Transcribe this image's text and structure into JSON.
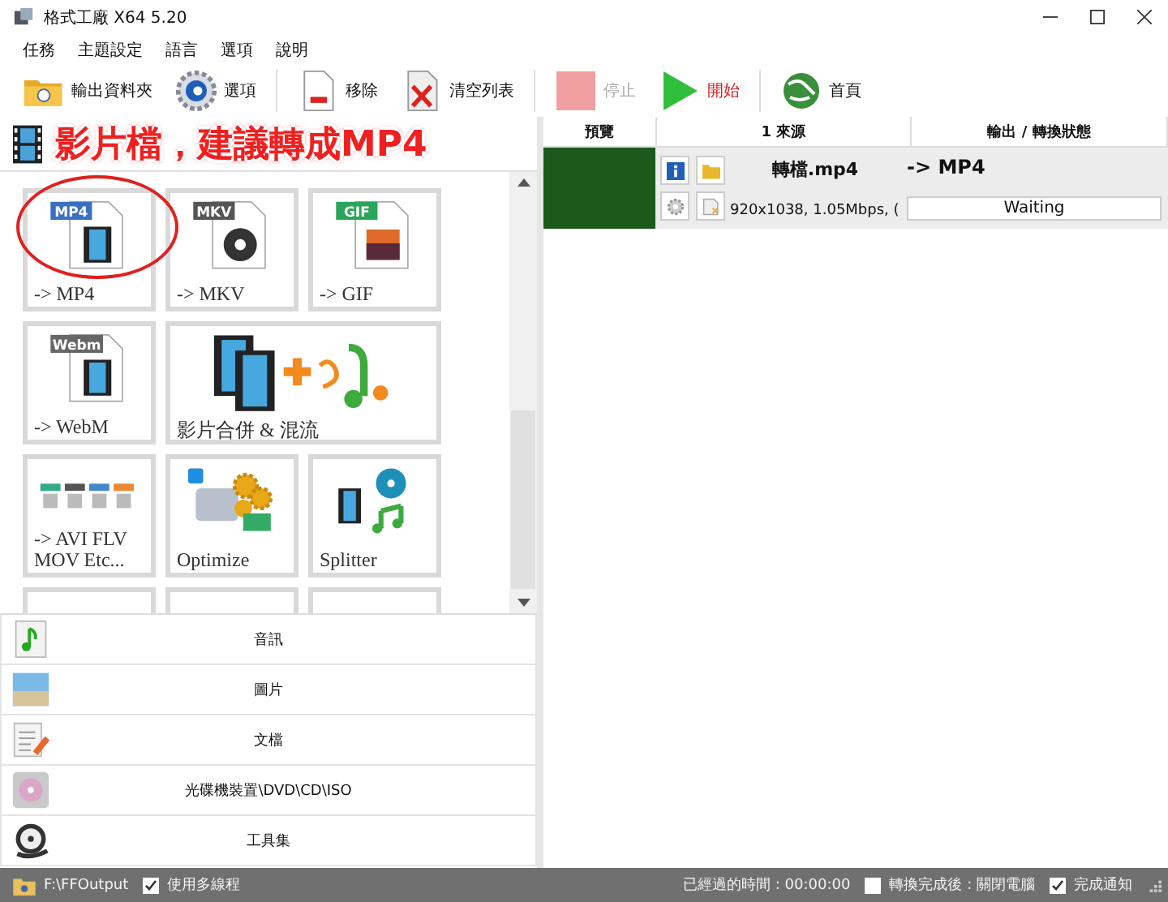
{
  "window": {
    "title": "格式工廠 X64 5.20"
  },
  "menu": [
    "任務",
    "主題設定",
    "語言",
    "選項",
    "說明"
  ],
  "toolbar": [
    {
      "label": "輸出資料夾",
      "kind": "folder",
      "disabled": false
    },
    {
      "label": "選項",
      "kind": "gear",
      "disabled": false
    },
    {
      "label": "移除",
      "kind": "remove",
      "disabled": false
    },
    {
      "label": "清空列表",
      "kind": "clear",
      "disabled": false
    },
    {
      "label": "停止",
      "kind": "stop",
      "disabled": true
    },
    {
      "label": "開始",
      "kind": "start",
      "disabled": false
    },
    {
      "label": "首頁",
      "kind": "home",
      "disabled": false
    }
  ],
  "category_header": {
    "title": "影片檔，建議轉成MP4"
  },
  "tiles": [
    {
      "label": "-> MP4",
      "kind": "file",
      "badge": "MP4",
      "color": "#3b6fc4",
      "circled": true
    },
    {
      "label": "-> MKV",
      "kind": "disc",
      "badge": "MKV",
      "color": "#555555",
      "circled": false
    },
    {
      "label": "-> GIF",
      "kind": "photo",
      "badge": "GIF",
      "color": "#2aa55a",
      "circled": false
    },
    {
      "label": "-> WebM",
      "kind": "file",
      "badge": "Webm",
      "color": "#666666",
      "circled": false
    },
    {
      "label": "影片合併 & 混流",
      "kind": "join",
      "circled": false
    },
    {
      "label": "-> AVI FLV MOV Etc...",
      "kind": "formats",
      "circled": false
    },
    {
      "label": "Optimize",
      "kind": "optimize",
      "circled": false
    },
    {
      "label": "Splitter",
      "kind": "splitter",
      "circled": false
    }
  ],
  "categories": [
    {
      "label": "音訊",
      "kind": "audio"
    },
    {
      "label": "圖片",
      "kind": "picture"
    },
    {
      "label": "文檔",
      "kind": "document"
    },
    {
      "label": "光碟機裝置\\DVD\\CD\\ISO",
      "kind": "disc"
    },
    {
      "label": "工具集",
      "kind": "tools"
    }
  ],
  "task_table": {
    "columns": [
      "預覽",
      "1 來源",
      "輸出 / 轉換狀態"
    ],
    "rows": [
      {
        "source": "轉檔.mp4",
        "details": "920x1038, 1.05Mbps, (",
        "output": "-> MP4",
        "status": "Waiting"
      }
    ]
  },
  "status_bar": {
    "output_folder": "F:\\FFOutput",
    "multithread": {
      "label": "使用多線程",
      "checked": true
    },
    "elapsed": "已經過的時間 : 00:00:00",
    "shutdown": {
      "label": "轉換完成後 : 關閉電腦",
      "checked": false
    },
    "notify": {
      "label": "完成通知",
      "checked": true
    }
  }
}
